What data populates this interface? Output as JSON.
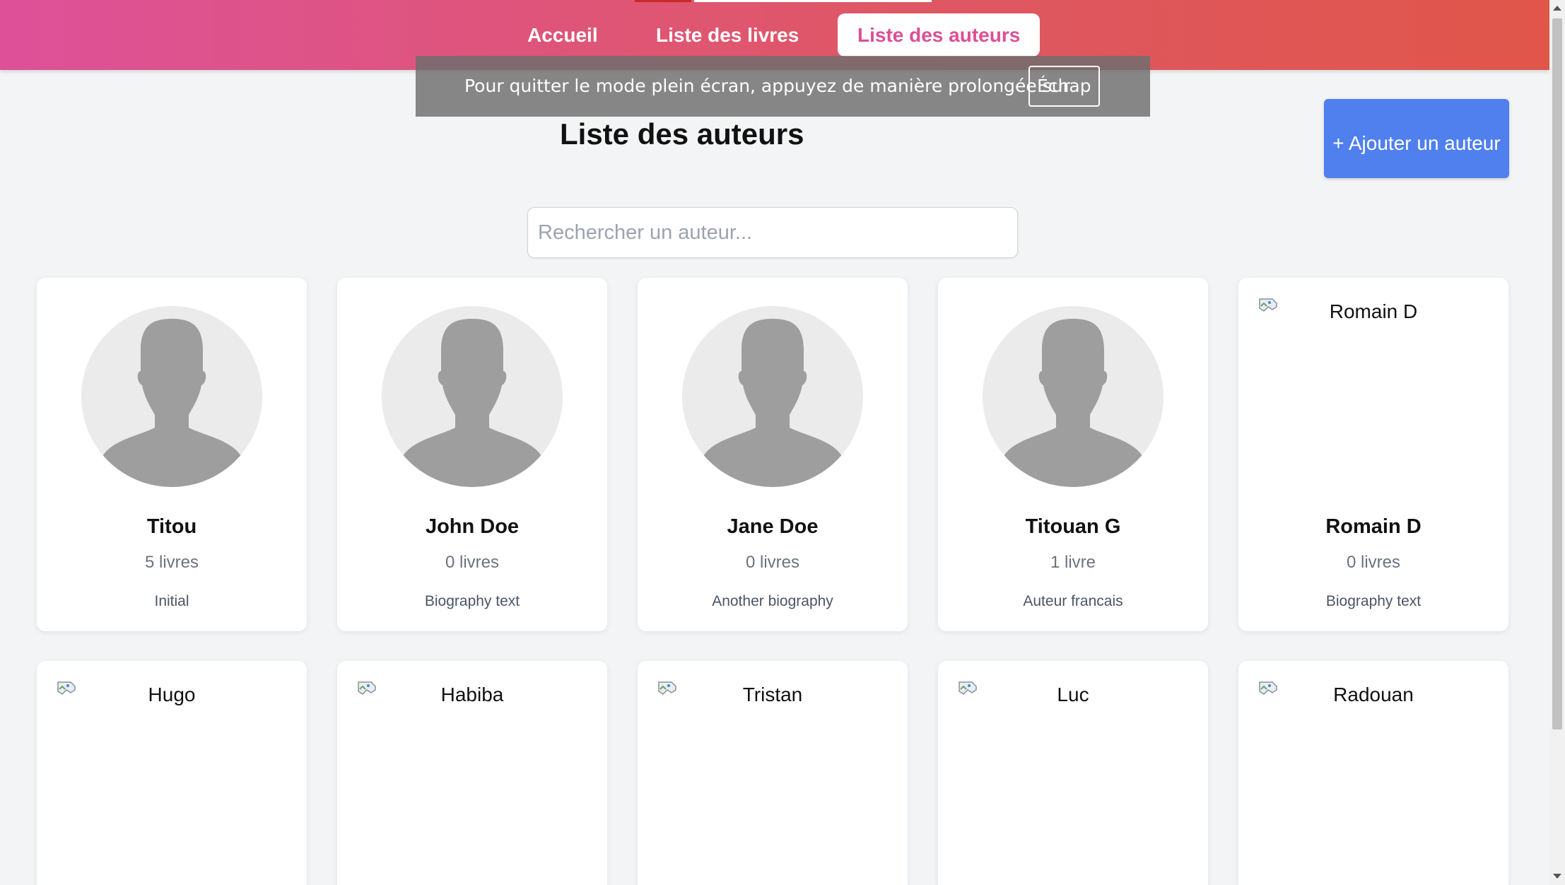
{
  "nav": {
    "items": [
      {
        "label": "Accueil",
        "active": false
      },
      {
        "label": "Liste des livres",
        "active": false
      },
      {
        "label": "Liste des auteurs",
        "active": true
      }
    ]
  },
  "toast": {
    "text": "Pour quitter le mode plein écran, appuyez de manière prolongée sur",
    "key": "Échap"
  },
  "page": {
    "title": "Liste des auteurs",
    "add_button_label": "+ Ajouter un auteur"
  },
  "search": {
    "placeholder": "Rechercher un auteur...",
    "value": ""
  },
  "authors": [
    {
      "name": "Titou",
      "books": "5 livres",
      "bio": "Initial",
      "image": "placeholder-avatar"
    },
    {
      "name": "John Doe",
      "books": "0 livres",
      "bio": "Biography text",
      "image": "placeholder-avatar"
    },
    {
      "name": "Jane Doe",
      "books": "0 livres",
      "bio": "Another biography",
      "image": "placeholder-avatar"
    },
    {
      "name": "Titouan G",
      "books": "1 livre",
      "bio": "Auteur francais",
      "image": "placeholder-avatar"
    },
    {
      "name": "Romain D",
      "books": "0 livres",
      "bio": "Biography text",
      "image": "broken-image",
      "alt": "Romain D"
    },
    {
      "name": "Hugo",
      "image": "broken-image",
      "alt": "Hugo"
    },
    {
      "name": "Habiba",
      "image": "broken-image",
      "alt": "Habiba"
    },
    {
      "name": "Tristan",
      "image": "broken-image",
      "alt": "Tristan"
    },
    {
      "name": "Luc",
      "image": "broken-image",
      "alt": "Luc"
    },
    {
      "name": "Radouan",
      "image": "broken-image",
      "alt": "Radouan"
    }
  ],
  "colors": {
    "header_gradient_start": "#de5199",
    "header_gradient_end": "#e0564a",
    "active_tab_text": "#dc4f96",
    "add_button": "#4f80ee",
    "background": "#f3f4f6",
    "avatar_bg": "#ebebeb",
    "avatar_silhouette": "#9e9e9e"
  }
}
